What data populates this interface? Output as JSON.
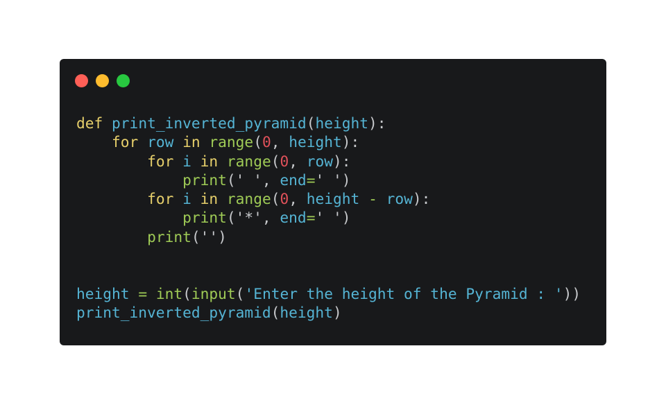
{
  "window": {
    "controls": [
      {
        "name": "close",
        "color": "#ff5f57"
      },
      {
        "name": "minimize",
        "color": "#febc2e"
      },
      {
        "name": "maximize",
        "color": "#28c840"
      }
    ]
  },
  "code": {
    "language": "python",
    "lines": [
      [
        [
          "kw",
          "def"
        ],
        [
          "pn",
          " "
        ],
        [
          "id",
          "print_inverted_pyramid"
        ],
        [
          "pn",
          "("
        ],
        [
          "id",
          "height"
        ],
        [
          "pn",
          "):"
        ]
      ],
      [
        [
          "pn",
          "    "
        ],
        [
          "kw",
          "for"
        ],
        [
          "pn",
          " "
        ],
        [
          "id",
          "row"
        ],
        [
          "pn",
          " "
        ],
        [
          "kw",
          "in"
        ],
        [
          "pn",
          " "
        ],
        [
          "fn",
          "range"
        ],
        [
          "pn",
          "("
        ],
        [
          "num",
          "0"
        ],
        [
          "pn",
          ", "
        ],
        [
          "id",
          "height"
        ],
        [
          "pn",
          "):"
        ]
      ],
      [
        [
          "pn",
          "        "
        ],
        [
          "kw",
          "for"
        ],
        [
          "pn",
          " "
        ],
        [
          "id",
          "i"
        ],
        [
          "pn",
          " "
        ],
        [
          "kw",
          "in"
        ],
        [
          "pn",
          " "
        ],
        [
          "fn",
          "range"
        ],
        [
          "pn",
          "("
        ],
        [
          "num",
          "0"
        ],
        [
          "pn",
          ", "
        ],
        [
          "id",
          "row"
        ],
        [
          "pn",
          "):"
        ]
      ],
      [
        [
          "pn",
          "            "
        ],
        [
          "fn",
          "print"
        ],
        [
          "pn",
          "("
        ],
        [
          "str",
          "' '"
        ],
        [
          "pn",
          ", "
        ],
        [
          "id",
          "end"
        ],
        [
          "op",
          "="
        ],
        [
          "str",
          "' '"
        ],
        [
          "pn",
          ")"
        ]
      ],
      [
        [
          "pn",
          "        "
        ],
        [
          "kw",
          "for"
        ],
        [
          "pn",
          " "
        ],
        [
          "id",
          "i"
        ],
        [
          "pn",
          " "
        ],
        [
          "kw",
          "in"
        ],
        [
          "pn",
          " "
        ],
        [
          "fn",
          "range"
        ],
        [
          "pn",
          "("
        ],
        [
          "num",
          "0"
        ],
        [
          "pn",
          ", "
        ],
        [
          "id",
          "height"
        ],
        [
          "pn",
          " "
        ],
        [
          "op",
          "-"
        ],
        [
          "pn",
          " "
        ],
        [
          "id",
          "row"
        ],
        [
          "pn",
          "):"
        ]
      ],
      [
        [
          "pn",
          "            "
        ],
        [
          "fn",
          "print"
        ],
        [
          "pn",
          "("
        ],
        [
          "str",
          "'*'"
        ],
        [
          "pn",
          ", "
        ],
        [
          "id",
          "end"
        ],
        [
          "op",
          "="
        ],
        [
          "str",
          "' '"
        ],
        [
          "pn",
          ")"
        ]
      ],
      [
        [
          "pn",
          "        "
        ],
        [
          "fn",
          "print"
        ],
        [
          "pn",
          "("
        ],
        [
          "str",
          "''"
        ],
        [
          "pn",
          ")"
        ]
      ],
      [],
      [],
      [
        [
          "id",
          "height"
        ],
        [
          "pn",
          " "
        ],
        [
          "op",
          "="
        ],
        [
          "pn",
          " "
        ],
        [
          "fn",
          "int"
        ],
        [
          "pn",
          "("
        ],
        [
          "fn",
          "input"
        ],
        [
          "pn",
          "("
        ],
        [
          "str2",
          "'Enter the height of the Pyramid : '"
        ],
        [
          "pn",
          "))"
        ]
      ],
      [
        [
          "id",
          "print_inverted_pyramid"
        ],
        [
          "pn",
          "("
        ],
        [
          "id",
          "height"
        ],
        [
          "pn",
          ")"
        ]
      ]
    ]
  }
}
